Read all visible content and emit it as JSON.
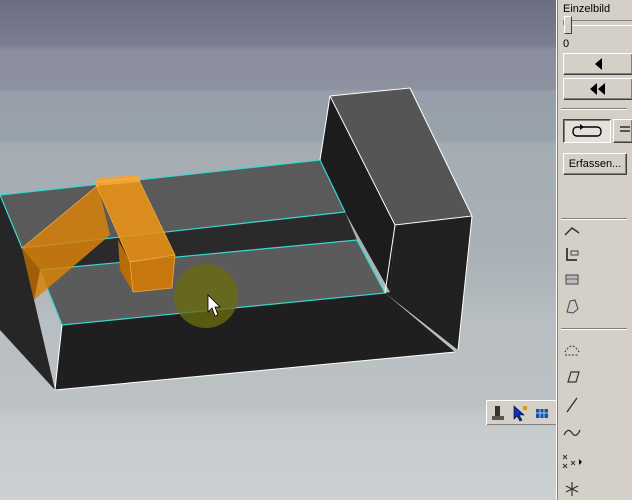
{
  "panel": {
    "frame_title": "Einzelbild",
    "frame_value": "0",
    "capture_label": "Erfassen..."
  },
  "icons": {
    "prev_frame": "triangle-left-icon",
    "rewind": "double-triangle-left-icon",
    "loop": "loop-icon",
    "play_once": "arrow-right-icon"
  },
  "colors": {
    "viewport_edge_highlight": "#38d8d0",
    "selected_part": "#e08a0c",
    "part_body_dark": "#222222",
    "part_top_face": "#585858",
    "cursor_highlight": "#6a6a10"
  }
}
